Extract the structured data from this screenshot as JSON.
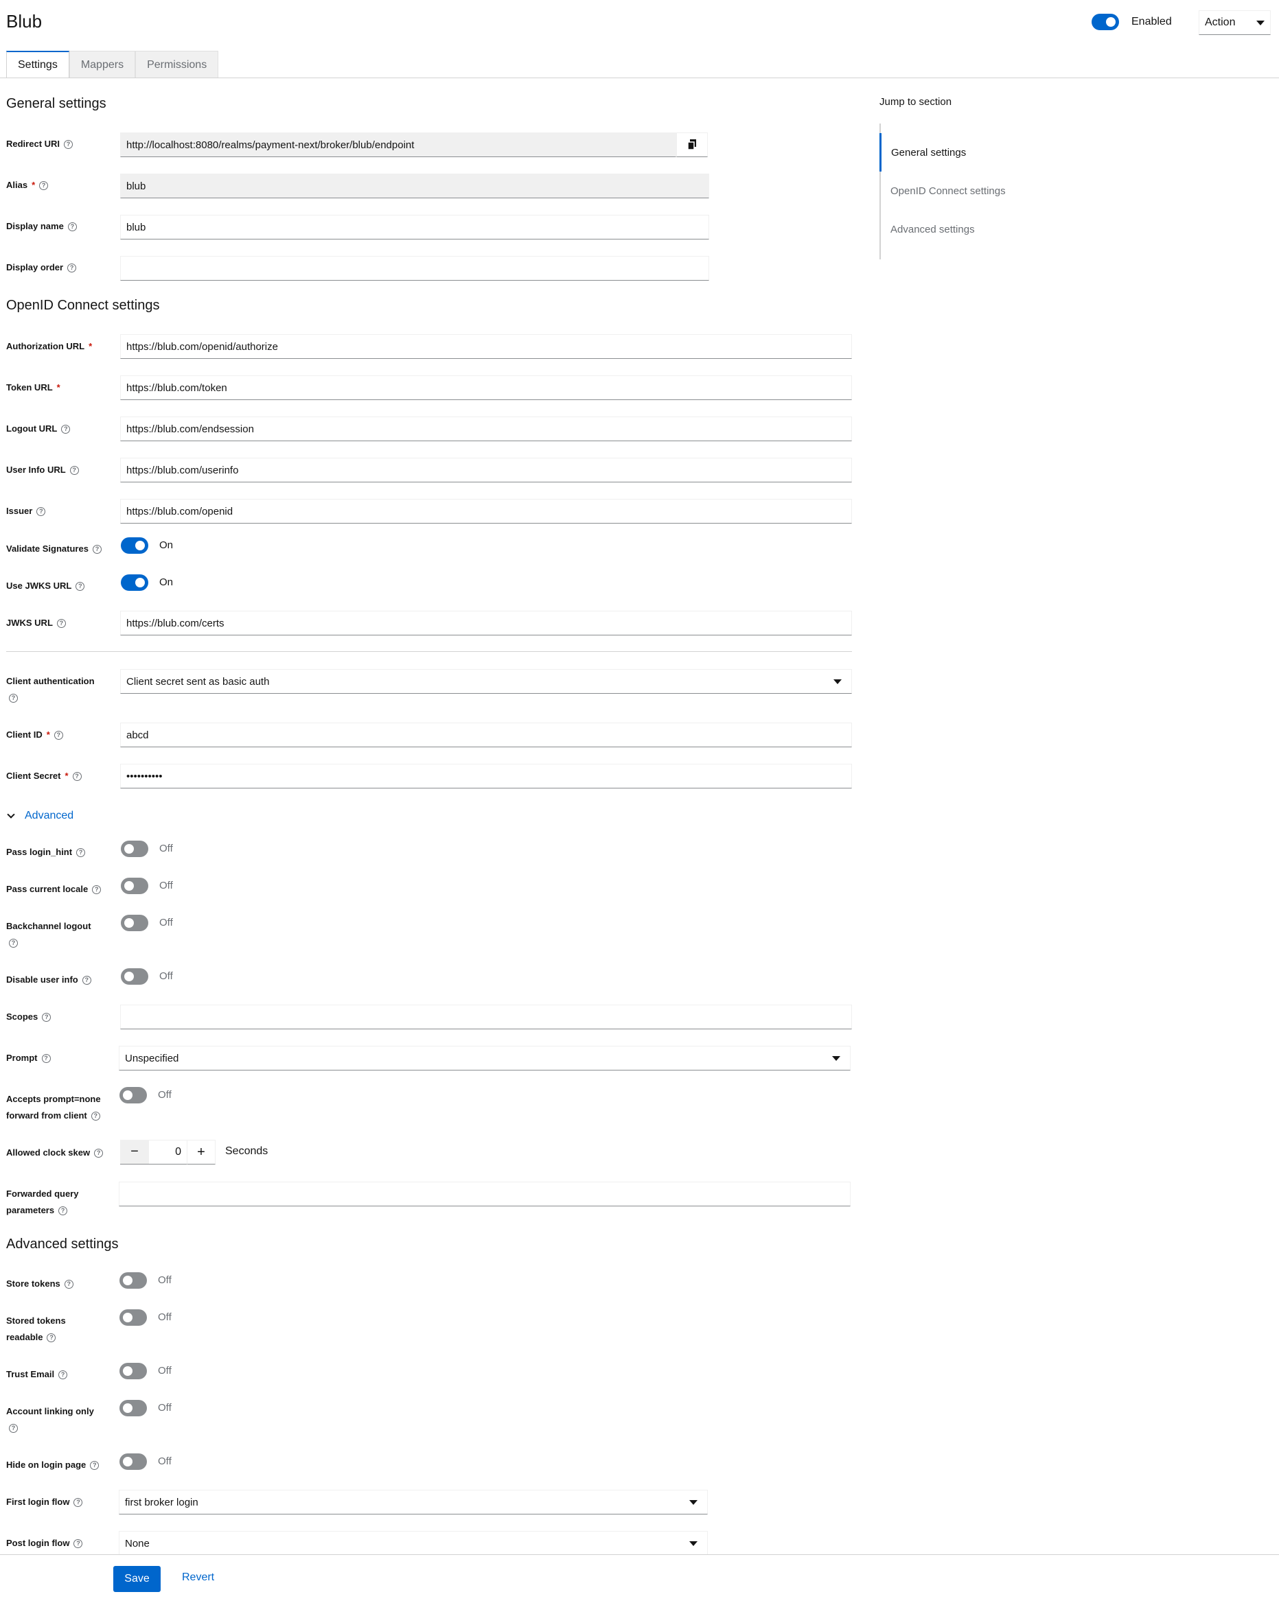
{
  "header": {
    "title": "Blub",
    "enabled_label": "Enabled",
    "action_label": "Action"
  },
  "tabs": [
    {
      "label": "Settings"
    },
    {
      "label": "Mappers"
    },
    {
      "label": "Permissions"
    }
  ],
  "general": {
    "title": "General settings",
    "redirect_uri_label": "Redirect URI",
    "redirect_uri_value": "http://localhost:8080/realms/payment-next/broker/blub/endpoint",
    "alias_label": "Alias",
    "alias_value": "blub",
    "display_name_label": "Display name",
    "display_name_value": "blub",
    "display_order_label": "Display order",
    "display_order_value": ""
  },
  "oidc": {
    "title": "OpenID Connect settings",
    "authorization_url_label": "Authorization URL",
    "authorization_url_value": "https://blub.com/openid/authorize",
    "token_url_label": "Token URL",
    "token_url_value": "https://blub.com/token",
    "logout_url_label": "Logout URL",
    "logout_url_value": "https://blub.com/endsession",
    "user_info_url_label": "User Info URL",
    "user_info_url_value": "https://blub.com/userinfo",
    "issuer_label": "Issuer",
    "issuer_value": "https://blub.com/openid",
    "validate_signatures_label": "Validate Signatures",
    "validate_signatures_state": "On",
    "use_jwks_label": "Use JWKS URL",
    "use_jwks_state": "On",
    "jwks_url_label": "JWKS URL",
    "jwks_url_value": "https://blub.com/certs",
    "client_auth_label": "Client authentication",
    "client_auth_value": "Client secret sent as basic auth",
    "client_id_label": "Client ID",
    "client_id_value": "abcd",
    "client_secret_label": "Client Secret",
    "client_secret_value": "••••••••••"
  },
  "advanced_toggle": {
    "label": "Advanced"
  },
  "advanced": {
    "pass_login_hint_label": "Pass login_hint",
    "pass_current_locale_label": "Pass current locale",
    "backchannel_logout_label": "Backchannel logout",
    "disable_user_info_label": "Disable user info",
    "scopes_label": "Scopes",
    "scopes_value": "",
    "prompt_label": "Prompt",
    "prompt_value": "Unspecified",
    "accepts_prompt_label_1": "Accepts prompt=none",
    "accepts_prompt_label_2": "forward from client",
    "clock_skew_label": "Allowed clock skew",
    "clock_skew_value": "0",
    "clock_skew_minus": "−",
    "clock_skew_plus": "+",
    "clock_skew_unit": "Seconds",
    "forwarded_query_label_1": "Forwarded query",
    "forwarded_query_label_2": "parameters",
    "forwarded_query_value": ""
  },
  "advanced_settings": {
    "title": "Advanced settings",
    "store_tokens_label": "Store tokens",
    "stored_tokens_readable_label_1": "Stored tokens",
    "stored_tokens_readable_label_2": "readable",
    "trust_email_label": "Trust Email",
    "account_linking_only_label": "Account linking only",
    "hide_on_login_page_label": "Hide on login page",
    "first_login_flow_label": "First login flow",
    "first_login_flow_value": "first broker login",
    "post_login_flow_label": "Post login flow",
    "post_login_flow_value": "None"
  },
  "switch_states": {
    "on": "On",
    "off": "Off"
  },
  "jump": {
    "title": "Jump to section",
    "items": [
      {
        "label": "General settings"
      },
      {
        "label": "OpenID Connect settings"
      },
      {
        "label": "Advanced settings"
      }
    ]
  },
  "footer": {
    "save_label": "Save",
    "revert_label": "Revert"
  },
  "colors": {
    "accent": "#0066cc",
    "required": "#c9190b",
    "switch_off": "#8a8d90"
  }
}
